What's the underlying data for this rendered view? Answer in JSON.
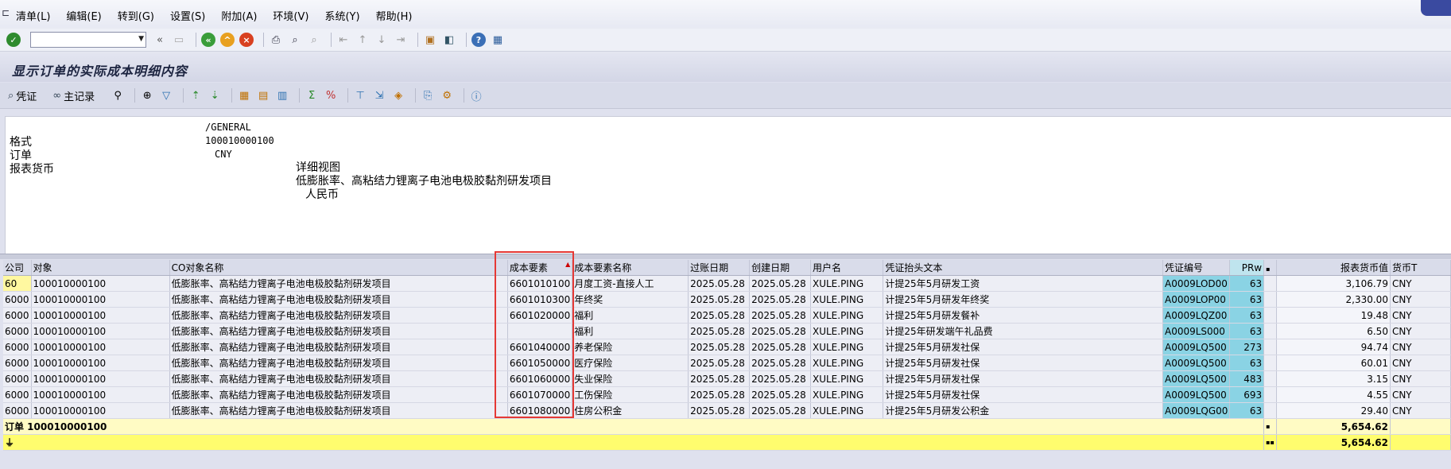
{
  "menubar": {
    "items": [
      "清单(L)",
      "编辑(E)",
      "转到(G)",
      "设置(S)",
      "附加(A)",
      "环境(V)",
      "系统(Y)",
      "帮助(H)"
    ]
  },
  "toolbar": {
    "command_field_value": "",
    "icons": [
      "check-icon",
      "save-icon",
      "back-icon",
      "exit-icon",
      "cancel-icon",
      "print-icon",
      "find-icon",
      "find-next-icon",
      "first-page-icon",
      "prev-page-icon",
      "next-page-icon",
      "last-page-icon",
      "new-session-icon",
      "shortcut-icon",
      "help-icon",
      "layout-icon"
    ]
  },
  "title": "显示订单的实际成本明细内容",
  "app_toolbar": {
    "voucher_label": "凭证",
    "master_record_label": "主记录"
  },
  "header": {
    "rows": [
      {
        "label": "格式",
        "code": "/GENERAL",
        "desc": "详细视图"
      },
      {
        "label": "订单",
        "code": "100010000100",
        "desc": "低膨胀率、高粘结力锂离子电池电极胶黏剂研发项目"
      },
      {
        "label": "报表货币",
        "code": "CNY",
        "desc": "人民币"
      }
    ]
  },
  "grid": {
    "columns": [
      "公司",
      "对象",
      "CO对象名称",
      "成本要素",
      "成本要素名称",
      "过账日期",
      "创建日期",
      "用户名",
      "凭证抬头文本",
      "凭证编号",
      "PRw",
      "",
      "报表货币值",
      "货币T"
    ],
    "rows": [
      {
        "company": "60",
        "object": "100010000100",
        "co_name": "低膨胀率、高粘结力锂离子电池电极胶黏剂研发项目",
        "cost_element": "6601010100",
        "cost_element_name": "月度工资-直接人工",
        "post_date": "2025.05.28",
        "create_date": "2025.05.28",
        "user": "XULE.PING",
        "header_text": "计提25年5月研发工资",
        "doc_no": "A0009LOD00",
        "prw": "63",
        "amount": "3,106.79",
        "currency": "CNY"
      },
      {
        "company": "6000",
        "object": "100010000100",
        "co_name": "低膨胀率、高粘结力锂离子电池电极胶黏剂研发项目",
        "cost_element": "6601010300",
        "cost_element_name": "年终奖",
        "post_date": "2025.05.28",
        "create_date": "2025.05.28",
        "user": "XULE.PING",
        "header_text": "计提25年5月研发年终奖",
        "doc_no": "A0009LOP00",
        "prw": "63",
        "amount": "2,330.00",
        "currency": "CNY"
      },
      {
        "company": "6000",
        "object": "100010000100",
        "co_name": "低膨胀率、高粘结力锂离子电池电极胶黏剂研发项目",
        "cost_element": "6601020000",
        "cost_element_name": "福利",
        "post_date": "2025.05.28",
        "create_date": "2025.05.28",
        "user": "XULE.PING",
        "header_text": "计提25年5月研发餐补",
        "doc_no": "A0009LQZ00",
        "prw": "63",
        "amount": "19.48",
        "currency": "CNY"
      },
      {
        "company": "6000",
        "object": "100010000100",
        "co_name": "低膨胀率、高粘结力锂离子电池电极胶黏剂研发项目",
        "cost_element": "",
        "cost_element_name": "福利",
        "post_date": "2025.05.28",
        "create_date": "2025.05.28",
        "user": "XULE.PING",
        "header_text": "计提25年研发端午礼品费",
        "doc_no": "A0009LS000",
        "prw": "63",
        "amount": "6.50",
        "currency": "CNY"
      },
      {
        "company": "6000",
        "object": "100010000100",
        "co_name": "低膨胀率、高粘结力锂离子电池电极胶黏剂研发项目",
        "cost_element": "6601040000",
        "cost_element_name": "养老保险",
        "post_date": "2025.05.28",
        "create_date": "2025.05.28",
        "user": "XULE.PING",
        "header_text": "计提25年5月研发社保",
        "doc_no": "A0009LQ500",
        "prw": "273",
        "amount": "94.74",
        "currency": "CNY"
      },
      {
        "company": "6000",
        "object": "100010000100",
        "co_name": "低膨胀率、高粘结力锂离子电池电极胶黏剂研发项目",
        "cost_element": "6601050000",
        "cost_element_name": "医疗保险",
        "post_date": "2025.05.28",
        "create_date": "2025.05.28",
        "user": "XULE.PING",
        "header_text": "计提25年5月研发社保",
        "doc_no": "A0009LQ500",
        "prw": "63",
        "amount": "60.01",
        "currency": "CNY"
      },
      {
        "company": "6000",
        "object": "100010000100",
        "co_name": "低膨胀率、高粘结力锂离子电池电极胶黏剂研发项目",
        "cost_element": "6601060000",
        "cost_element_name": "失业保险",
        "post_date": "2025.05.28",
        "create_date": "2025.05.28",
        "user": "XULE.PING",
        "header_text": "计提25年5月研发社保",
        "doc_no": "A0009LQ500",
        "prw": "483",
        "amount": "3.15",
        "currency": "CNY"
      },
      {
        "company": "6000",
        "object": "100010000100",
        "co_name": "低膨胀率、高粘结力锂离子电池电极胶黏剂研发项目",
        "cost_element": "6601070000",
        "cost_element_name": "工伤保险",
        "post_date": "2025.05.28",
        "create_date": "2025.05.28",
        "user": "XULE.PING",
        "header_text": "计提25年5月研发社保",
        "doc_no": "A0009LQ500",
        "prw": "693",
        "amount": "4.55",
        "currency": "CNY"
      },
      {
        "company": "6000",
        "object": "100010000100",
        "co_name": "低膨胀率、高粘结力锂离子电池电极胶黏剂研发项目",
        "cost_element": "6601080000",
        "cost_element_name": "住房公积金",
        "post_date": "2025.05.28",
        "create_date": "2025.05.28",
        "user": "XULE.PING",
        "header_text": "计提25年5月研发公积金",
        "doc_no": "A0009LQG00",
        "prw": "63",
        "amount": "29.40",
        "currency": "CNY"
      }
    ],
    "subtotal": {
      "label": "订单 100010000100",
      "amount": "5,654.62"
    },
    "total": {
      "amount": "5,654.62"
    }
  },
  "colors": {
    "highlight_box": "#e53935",
    "doc_column": "#8ad3e4",
    "total_row": "#fffd6e",
    "subtotal_row": "#fffbc4"
  }
}
